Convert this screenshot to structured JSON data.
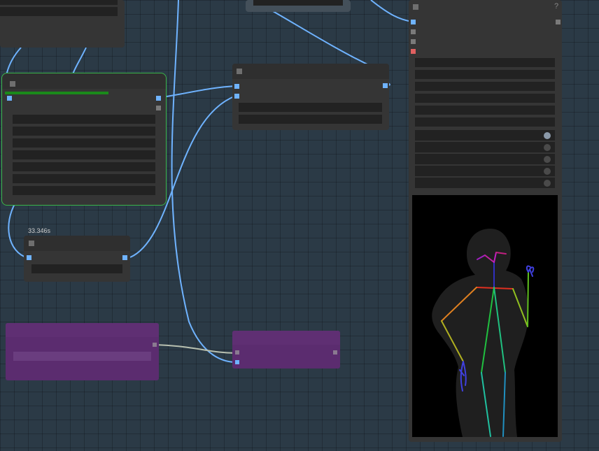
{
  "canvas": {
    "timing_label": "33.346s",
    "help_label": "?"
  },
  "colors": {
    "link": "#6fb3ff",
    "link_gray": "#b8c0b0",
    "node": "#353535",
    "active_border": "#39b54a",
    "progress": "#1a8a1a",
    "group_purple": "#5b2c6f"
  },
  "active_node": {
    "progress_fraction": 0.6
  },
  "pose_preview": {
    "image_description": "pose-skeleton-render"
  }
}
